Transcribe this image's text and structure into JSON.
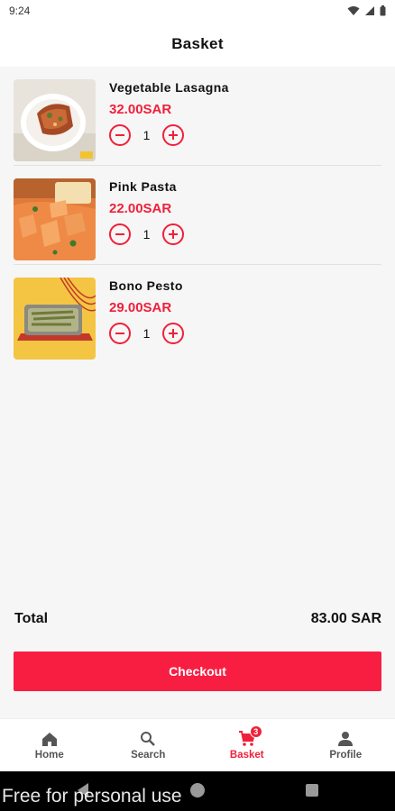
{
  "status_bar": {
    "time": "9:24"
  },
  "app_bar": {
    "title": "Basket"
  },
  "items": [
    {
      "name": "Vegetable Lasagna",
      "price": "32.00SAR",
      "qty": "1"
    },
    {
      "name": "Pink Pasta",
      "price": "22.00SAR",
      "qty": "1"
    },
    {
      "name": "Bono Pesto",
      "price": "29.00SAR",
      "qty": "1"
    }
  ],
  "summary": {
    "label": "Total",
    "value": "83.00 SAR"
  },
  "checkout_label": "Checkout",
  "nav": {
    "items": [
      {
        "label": "Home",
        "icon": "home-icon"
      },
      {
        "label": "Search",
        "icon": "search-icon"
      },
      {
        "label": "Basket",
        "icon": "cart-icon",
        "badge": "3"
      },
      {
        "label": "Profile",
        "icon": "person-icon"
      }
    ],
    "active": "Basket"
  },
  "watermark": "Free for personal use",
  "colors": {
    "accent": "#f0203a",
    "button": "#f81e42",
    "background": "#f6f6f6"
  }
}
